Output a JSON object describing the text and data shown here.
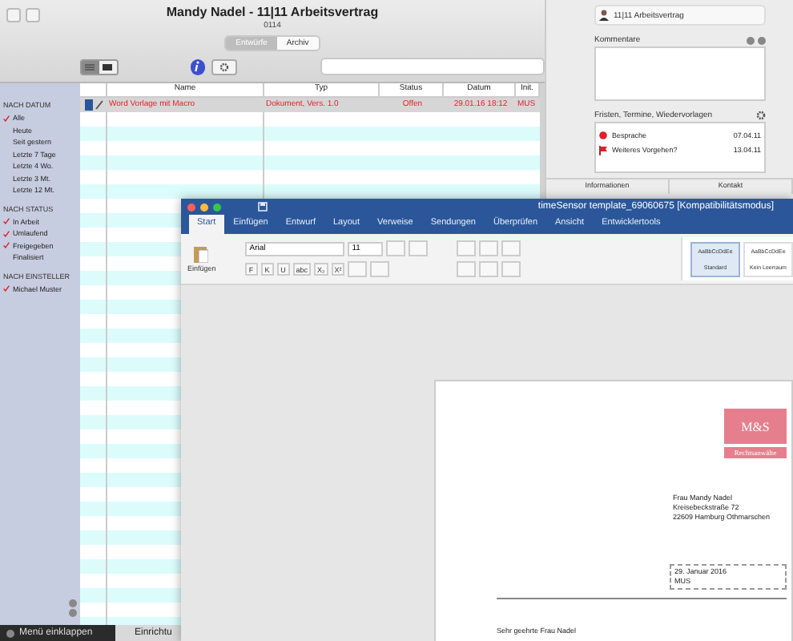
{
  "window": {
    "title": "Mandy Nadel - 11|11 Arbeitsvertrag",
    "subtitle": "0114"
  },
  "segments": [
    {
      "label": "Entwürfe",
      "selected": true
    },
    {
      "label": "Archiv",
      "selected": false
    }
  ],
  "view_toggle": [
    {
      "kind": "list",
      "selected": true
    },
    {
      "kind": "columns",
      "selected": false
    }
  ],
  "sidebar": {
    "sections": [
      {
        "title": "NACH DATUM",
        "items": [
          {
            "label": "Alle",
            "checked": true
          },
          {
            "label": "Heute",
            "checked": false
          },
          {
            "label": "Seit gestern",
            "checked": false
          },
          {
            "label": "Letzte 7 Tage",
            "checked": false
          },
          {
            "label": "Letzte 4 Wo.",
            "checked": false
          },
          {
            "label": "Letzte 3 Mt.",
            "checked": false
          },
          {
            "label": "Letzte 12 Mt.",
            "checked": false
          }
        ]
      },
      {
        "title": "NACH STATUS",
        "items": [
          {
            "label": "In Arbeit",
            "checked": true
          },
          {
            "label": "Umlaufend",
            "checked": true
          },
          {
            "label": "Freigegeben",
            "checked": true
          },
          {
            "label": "Finalisiert",
            "checked": false
          }
        ]
      },
      {
        "title": "NACH EINSTELLER",
        "items": [
          {
            "label": "Michael Muster",
            "checked": true
          }
        ]
      }
    ]
  },
  "table": {
    "columns": [
      "",
      "Name",
      "Typ",
      "Status",
      "Datum",
      "Init."
    ],
    "rows": [
      {
        "name": "Word Vorlage mit Macro",
        "type": "Dokument, Vers. 1.0",
        "status": "Offen",
        "date": "29.01.16 18:12",
        "init": "MUS",
        "selected": true
      }
    ]
  },
  "bottom_bar": {
    "collapse": "Menü einklappen",
    "tab": "Einrichtu"
  },
  "detail": {
    "record": "11|11 Arbeitsvertrag",
    "comments_label": "Kommentare",
    "deadlines_label": "Fristen, Termine, Wiedervorlagen",
    "deadlines": [
      {
        "kind": "meeting",
        "label": "Besprache",
        "date": "07.04.11"
      },
      {
        "kind": "flag",
        "label": "Weiteres Vorgehen?",
        "date": "13.04.11"
      }
    ],
    "tabs": [
      "Informationen",
      "Kontakt"
    ]
  },
  "word": {
    "title": "timeSensor template_69060675 [Kompatibilitätsmodus]",
    "tabs": [
      {
        "label": "Start",
        "selected": true
      },
      {
        "label": "Einfügen",
        "selected": false
      },
      {
        "label": "Entwurf",
        "selected": false
      },
      {
        "label": "Layout",
        "selected": false
      },
      {
        "label": "Verweise",
        "selected": false
      },
      {
        "label": "Sendungen",
        "selected": false
      },
      {
        "label": "Überprüfen",
        "selected": false
      },
      {
        "label": "Ansicht",
        "selected": false
      },
      {
        "label": "Entwicklertools",
        "selected": false
      }
    ],
    "paste_label": "Einfügen",
    "font": "Arial",
    "size": "11",
    "format_buttons": [
      "F",
      "K",
      "U",
      "abc",
      "X₂",
      "X²"
    ],
    "styles": [
      {
        "preview": "AaBbCcDdEe",
        "name": "Standard",
        "selected": true
      },
      {
        "preview": "AaBbCcDdEe",
        "name": "Kein Leerraum",
        "selected": false
      }
    ],
    "document": {
      "logo": "M&S",
      "logo_sub": "Rechtsanwälte",
      "address": [
        "Frau Mandy Nadel",
        "Kreisebeckstraße 72",
        "22609 Hamburg Othmarschen"
      ],
      "date_box": [
        "29. Januar 2016",
        "MUS"
      ],
      "salutation": "Sehr geehrte Frau Nadel"
    }
  }
}
